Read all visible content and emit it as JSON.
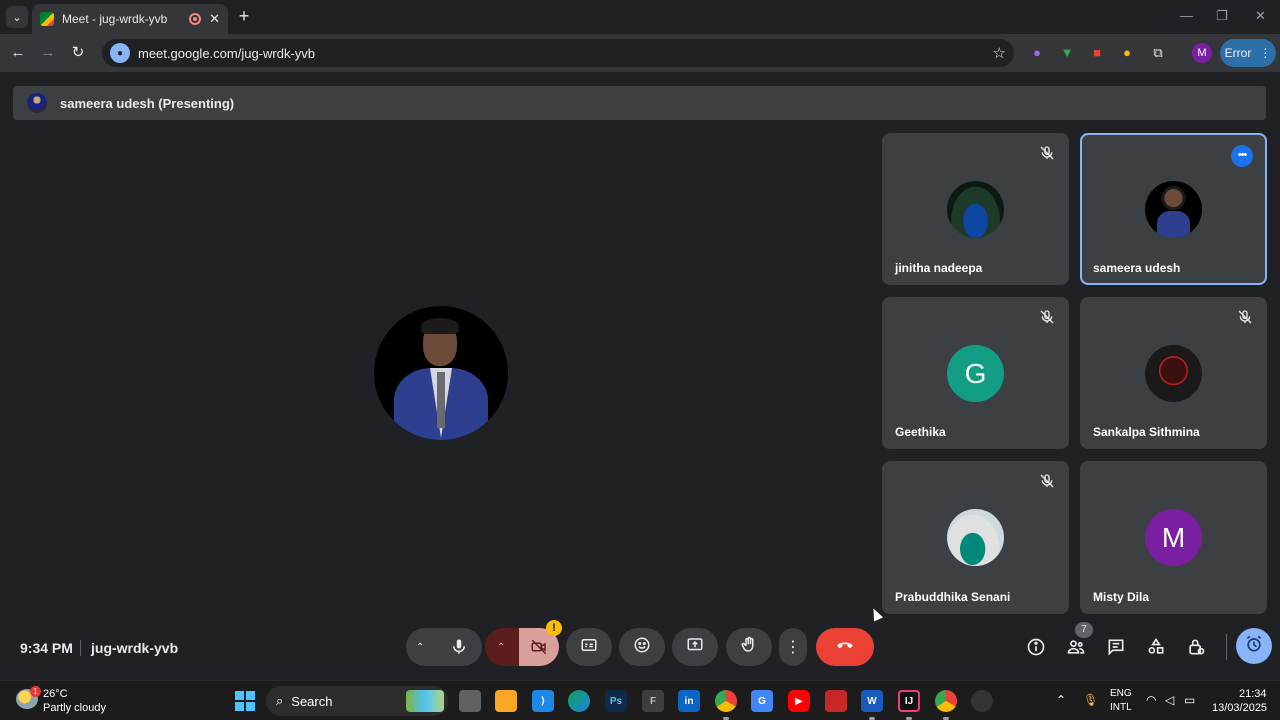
{
  "browser": {
    "tab_title": "Meet - jug-wrdk-yvb",
    "tab_close": "✕",
    "new_tab": "+",
    "url": "meet.google.com/jug-wrdk-yvb",
    "profile_initial": "M",
    "error_label": "Error"
  },
  "meet": {
    "presenting_text": "sameera udesh (Presenting)",
    "time": "9:34 PM",
    "meeting_code": "jug-wrdk-yvb",
    "participant_count": "7",
    "camera_warning": "!",
    "tiles": [
      {
        "name": "jinitha nadeepa",
        "muted": true,
        "avatar": "photo-car"
      },
      {
        "name": "sameera udesh",
        "muted": false,
        "active": true,
        "avatar": "photo-man"
      },
      {
        "name": "Geethika",
        "muted": true,
        "avatar_letter": "G",
        "avatar_color": "#129e85"
      },
      {
        "name": "Sankalpa Sithmina",
        "muted": true,
        "avatar": "photo-dark"
      },
      {
        "name": "Prabuddhika Senani",
        "muted": true,
        "avatar": "photo-woman"
      },
      {
        "name": "Misty Dila",
        "muted": false,
        "avatar_letter": "M",
        "avatar_color": "#7b1fa2"
      }
    ]
  },
  "taskbar": {
    "weather_badge": "1",
    "temperature": "26°C",
    "weather_desc": "Partly cloudy",
    "search_label": "Search",
    "lang_line1": "ENG",
    "lang_line2": "INTL",
    "clock_time": "21:34",
    "clock_date": "13/03/2025"
  },
  "colors": {
    "accent": "#8ab4f8",
    "hangup": "#ea4335",
    "camera_off": "#d99f9b",
    "mic_chevron_bg": "#5c1d1d"
  }
}
